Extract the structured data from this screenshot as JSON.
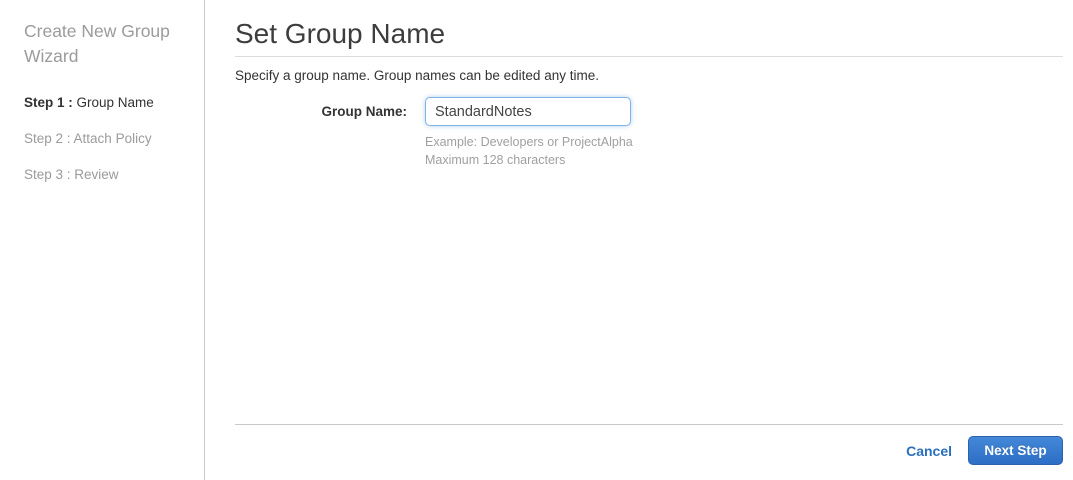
{
  "sidebar": {
    "title": "Create New Group Wizard",
    "steps": [
      {
        "prefix": "Step 1 : ",
        "label": "Group Name",
        "active": true
      },
      {
        "prefix": "Step 2 : ",
        "label": "Attach Policy",
        "active": false
      },
      {
        "prefix": "Step 3 : ",
        "label": "Review",
        "active": false
      }
    ]
  },
  "main": {
    "title": "Set Group Name",
    "description": "Specify a group name. Group names can be edited any time.",
    "form": {
      "group_name_label": "Group Name:",
      "group_name_value": "StandardNotes",
      "hint_example": "Example: Developers or ProjectAlpha",
      "hint_max": "Maximum 128 characters"
    },
    "footer": {
      "cancel_label": "Cancel",
      "next_label": "Next Step"
    }
  },
  "colors": {
    "link_blue": "#2a6fbd",
    "button_blue_top": "#4488d8",
    "button_blue_bottom": "#2d6ec6",
    "focused_input_border": "#84b3e4",
    "muted_gray": "#9b9b9b"
  }
}
